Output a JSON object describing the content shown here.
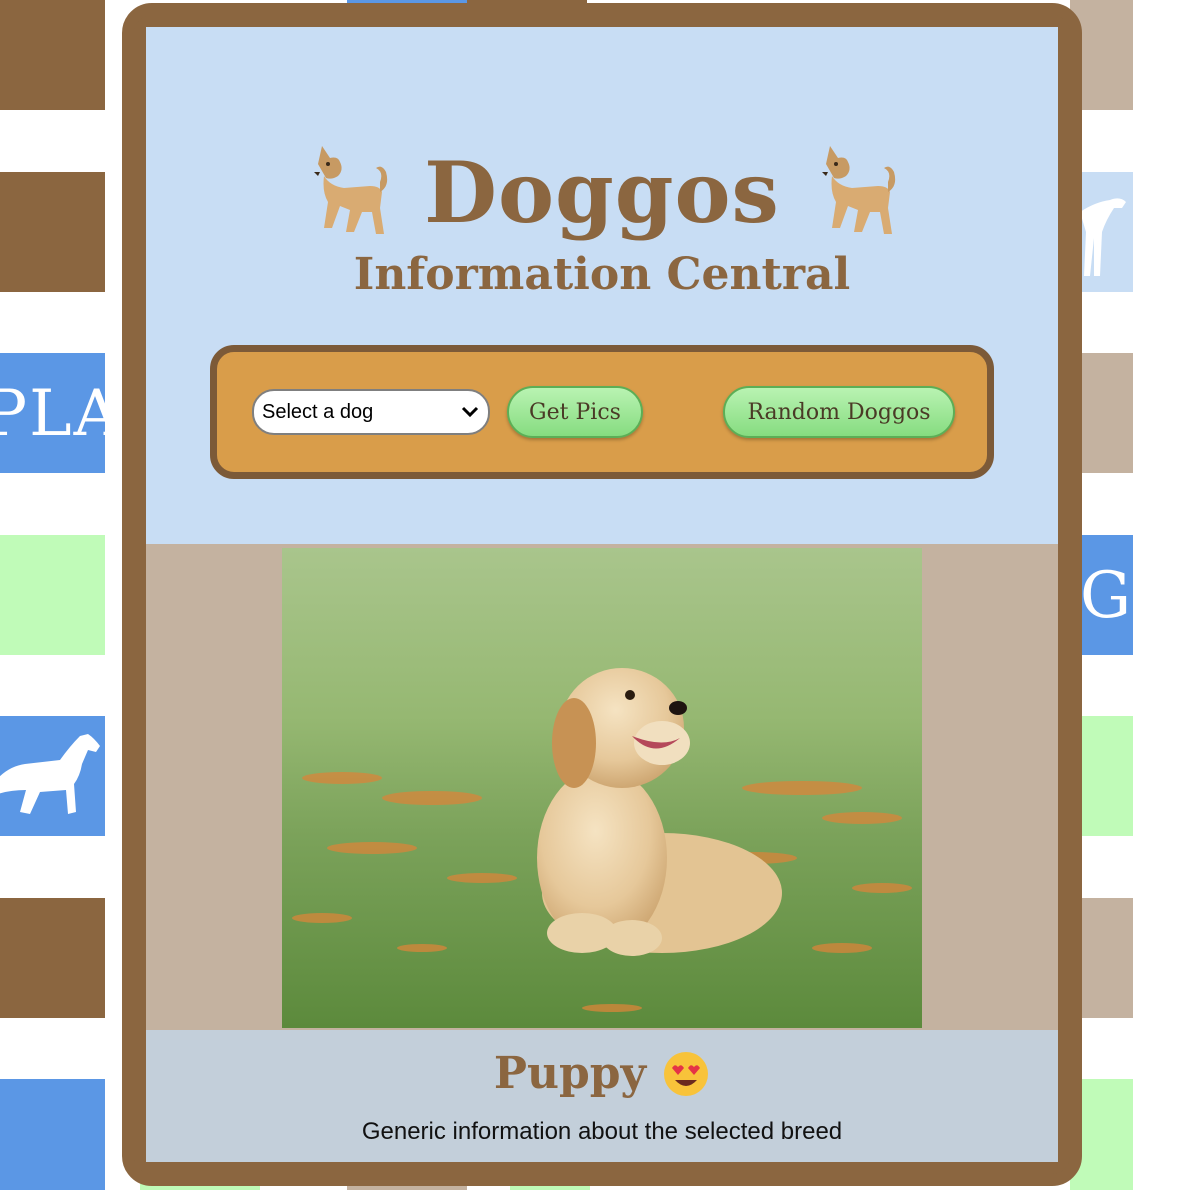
{
  "header": {
    "title": "Doggos",
    "subtitle": "Information Central",
    "title_icon": "dog-emoji"
  },
  "controls": {
    "select_value": "Select a dog",
    "get_pics_label": "Get Pics",
    "random_label": "Random Doggos"
  },
  "photo": {
    "subject": "golden retriever puppy in grass"
  },
  "info": {
    "breed": "Puppy",
    "breed_emoji": "heart-eyes-emoji",
    "description": "Generic information about the selected breed"
  },
  "background": {
    "left_text_1": "PLAY",
    "right_text_1": "G",
    "colors": {
      "brown": "#8b6640",
      "tan": "#c4b2a0",
      "blue": "#5b97e5",
      "green": "#c0fbb8",
      "light_blue": "#c8ddf4"
    }
  }
}
